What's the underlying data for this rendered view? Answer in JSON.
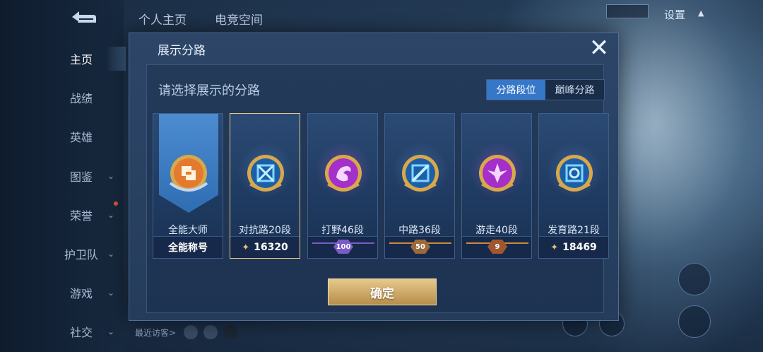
{
  "sidebar": {
    "items": [
      {
        "label": "主页",
        "chevron": false,
        "active": true
      },
      {
        "label": "战绩",
        "chevron": false
      },
      {
        "label": "英雄",
        "chevron": false
      },
      {
        "label": "图鉴",
        "chevron": true
      },
      {
        "label": "荣誉",
        "chevron": true
      },
      {
        "label": "护卫队",
        "chevron": true
      },
      {
        "label": "游戏",
        "chevron": true
      },
      {
        "label": "社交",
        "chevron": true
      }
    ]
  },
  "top_tabs": [
    "个人主页",
    "电竞空间"
  ],
  "settings_label": "设置",
  "footer": {
    "recent_visitors": "最近访客>"
  },
  "modal": {
    "title": "展示分路",
    "subtitle": "请选择展示的分路",
    "toggle": {
      "left": "分路段位",
      "right": "巅峰分路",
      "active": "left"
    },
    "confirm_label": "确定",
    "cards": [
      {
        "name": "全能大师",
        "bottom_text": "全能称号",
        "badge": "all-round-icon",
        "color": "#e0712e",
        "type": "title"
      },
      {
        "name": "对抗路20段",
        "points": "16320",
        "badge": "clash-lane-icon",
        "color": "#37a6e0",
        "type": "points",
        "selected": true
      },
      {
        "name": "打野46段",
        "rank": "100",
        "badge": "jungle-icon",
        "color": "#b23ed6",
        "type": "rank",
        "chip_color": "#7a5cc8"
      },
      {
        "name": "中路36段",
        "rank": "50",
        "badge": "mid-lane-icon",
        "color": "#37a6e0",
        "type": "rank",
        "chip_color": "#d08a3a"
      },
      {
        "name": "游走40段",
        "rank": "9",
        "badge": "roam-icon",
        "color": "#b23ed6",
        "type": "rank",
        "chip_color": "#d08a3a"
      },
      {
        "name": "发育路21段",
        "points": "18469",
        "badge": "farm-lane-icon",
        "color": "#37a6e0",
        "type": "points"
      }
    ]
  }
}
